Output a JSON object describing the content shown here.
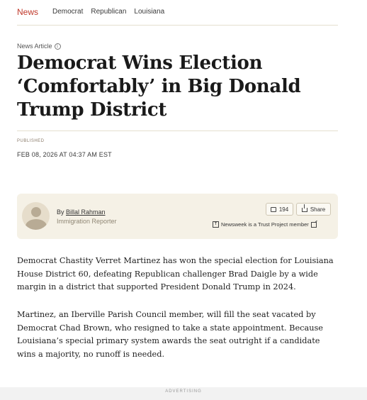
{
  "nav": {
    "brand": "News",
    "links": [
      "Democrat",
      "Republican",
      "Louisiana"
    ]
  },
  "article": {
    "kicker": "News Article",
    "headline": "Democrat Wins Election ‘Comfortably’ in Big Donald Trump District",
    "published_label": "PUBLISHED",
    "published_date": "FEB 08, 2026 AT 04:37 AM EST"
  },
  "author_card": {
    "by": "By",
    "author_name": "Billal Rahman",
    "author_role": "Immigration Reporter",
    "comment_count": "194",
    "share_label": "Share",
    "trust_text": "Newsweek is a Trust Project member"
  },
  "body": {
    "paragraphs": [
      "Democrat Chastity Verret Martinez has won the special election for Louisiana House District 60, defeating Republican challenger Brad Daigle by a wide margin in a district that supported President Donald Trump in 2024.",
      "Martinez, an Iberville Parish Council member, will fill the seat vacated by Democrat Chad Brown, who resigned to take a state appointment. Because Louisiana’s special primary system awards the seat outright if a candidate wins a majority, no runoff is needed."
    ]
  },
  "ad": {
    "label": "ADVERTISING"
  },
  "colors": {
    "brand": "#c0392b",
    "card_bg": "#f5f1e6",
    "rule": "#e4dfcf"
  }
}
